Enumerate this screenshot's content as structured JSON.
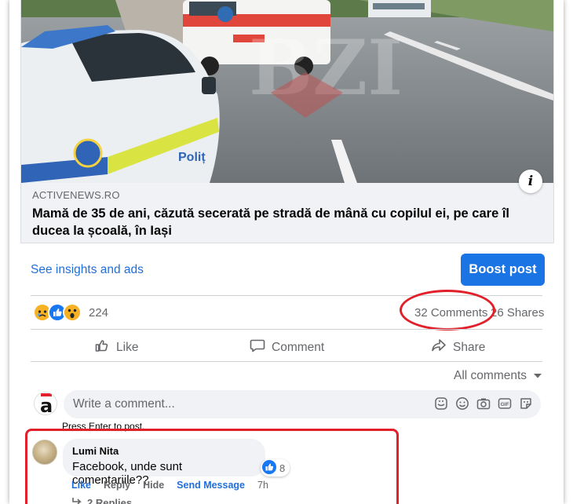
{
  "post": {
    "domain": "ACTIVENEWS.RO",
    "headline": "Mamă de 35 de ani, căzută secerată pe stradă de mână cu copilul ei, pe care îl ducea la școală, în Iași",
    "watermark": "BZI",
    "info_glyph": "i"
  },
  "insights": {
    "link_label": "See insights and ads",
    "boost_label": "Boost post",
    "boost_color": "#1b74e4"
  },
  "stats": {
    "reaction_icons": [
      "sad-icon",
      "like-icon",
      "wow-icon"
    ],
    "reaction_count": "224",
    "comments": "32 Comments",
    "shares": "26 Shares"
  },
  "actions": {
    "like": "Like",
    "comment": "Comment",
    "share": "Share"
  },
  "comments_section": {
    "filter_label": "All comments",
    "input_placeholder": "Write a comment...",
    "input_icons": [
      "sticker-icon",
      "emoji-icon",
      "camera-icon",
      "gif-icon",
      "avatar-sticker-icon"
    ],
    "hint": "Press Enter to post.",
    "avatar_letter": "a"
  },
  "comment": {
    "author": "Lumi Nita",
    "text": "Facebook, unde sunt comentariile??",
    "like_count": "8",
    "actions": {
      "like": "Like",
      "reply": "Reply",
      "hide": "Hide",
      "send_message": "Send Message",
      "time": "7h"
    },
    "replies_label": "2 Replies"
  },
  "highlight_color": "#e2202b"
}
